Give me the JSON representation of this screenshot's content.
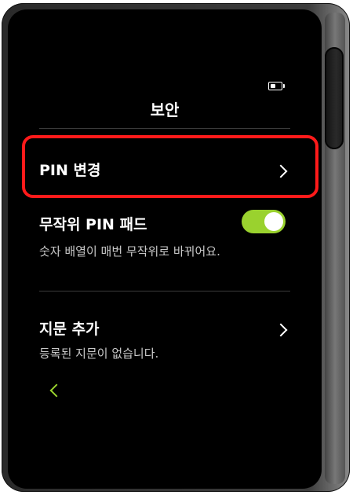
{
  "header": {
    "title": "보안",
    "battery_icon": "battery-icon"
  },
  "rows": [
    {
      "label": "PIN 변경",
      "chevron_icon": "chevron-right-icon",
      "highlighted": true
    },
    {
      "label": "무작위 PIN 패드",
      "subtitle": "숫자 배열이 매번 무작위로 바뀌어요.",
      "toggle_on": true
    },
    {
      "label": "지문 추가",
      "subtitle": "등록된 지문이 없습니다.",
      "chevron_icon": "chevron-right-icon"
    }
  ],
  "footer": {
    "back_icon": "chevron-left-icon"
  },
  "colors": {
    "accent": "#9ad22e",
    "highlight": "#ff1a1a",
    "background": "#000000",
    "text": "#ffffff",
    "subtext": "#c9c9c9"
  }
}
